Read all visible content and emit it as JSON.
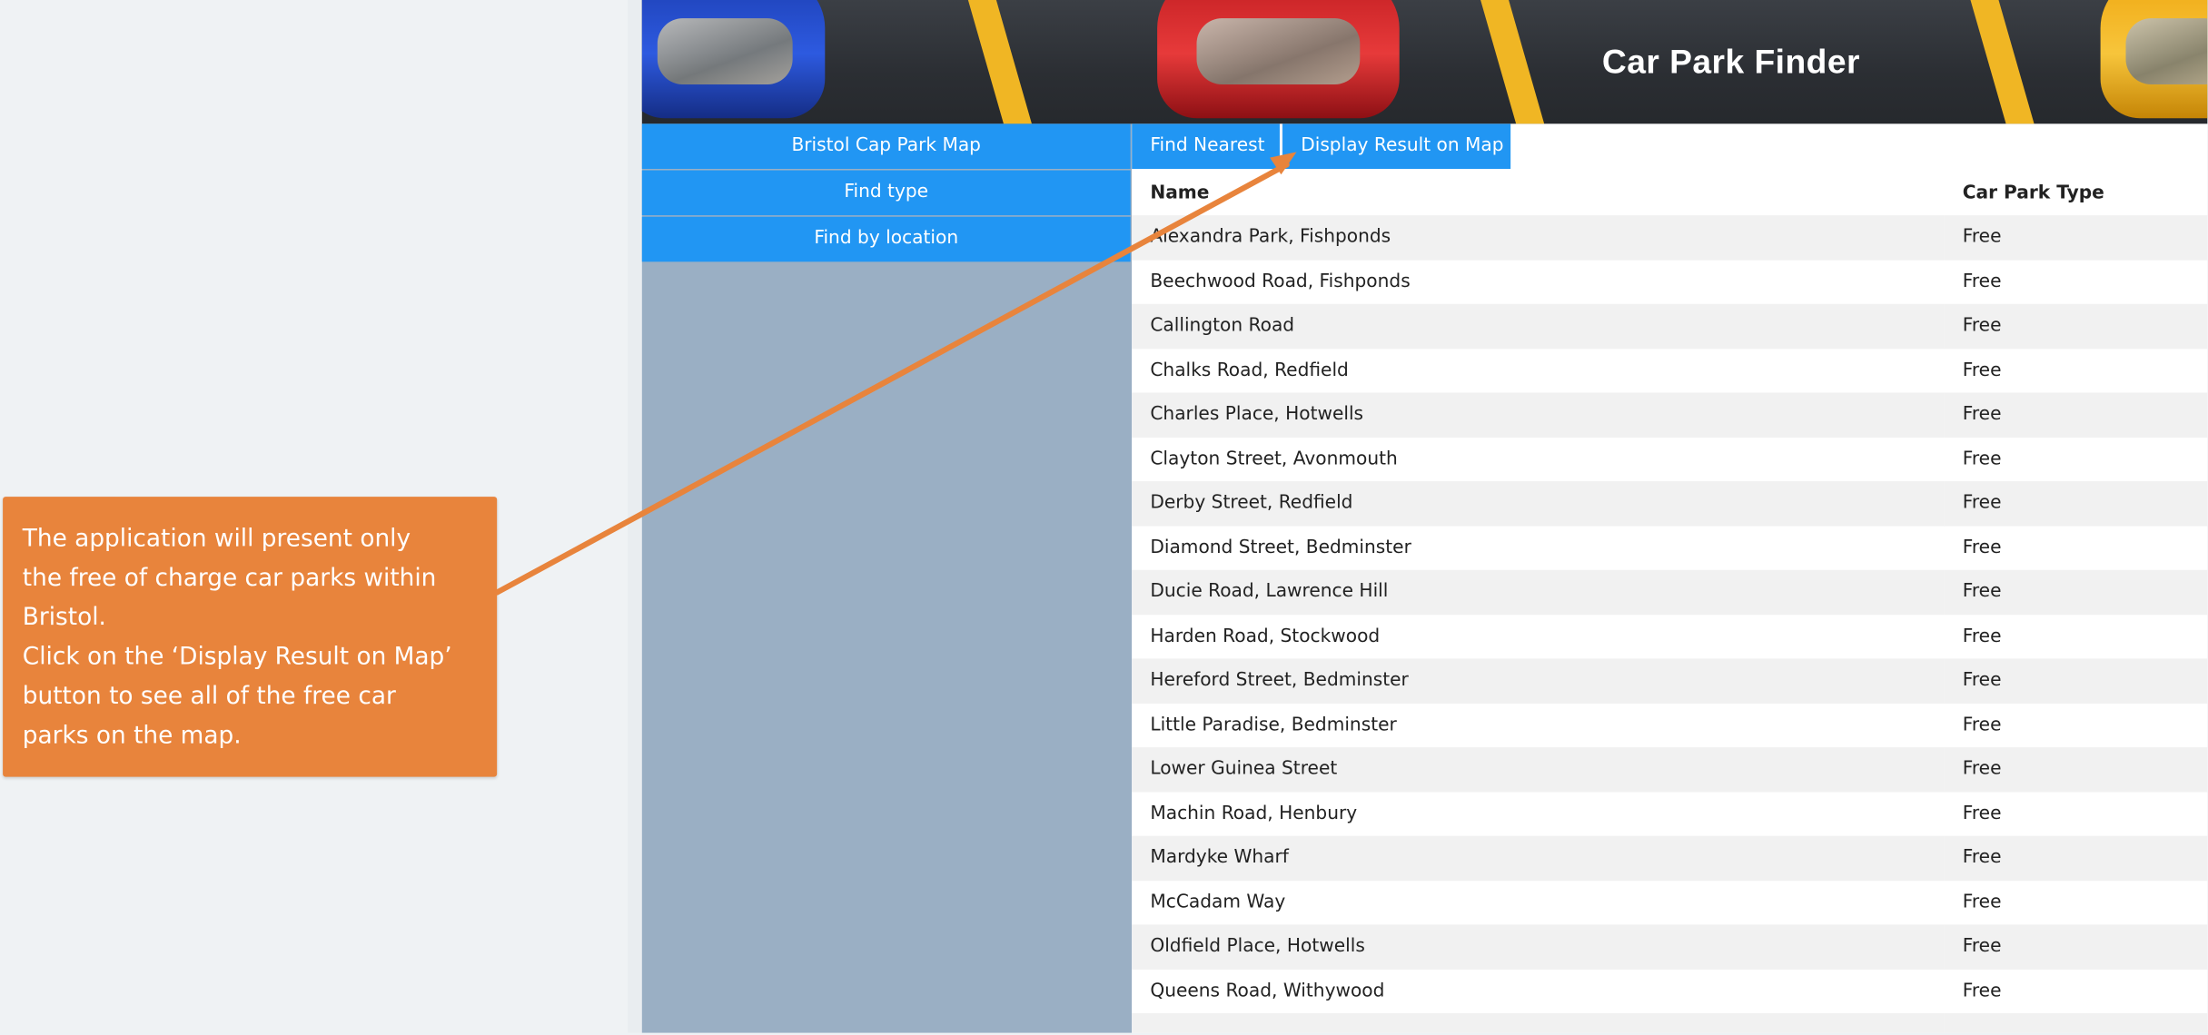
{
  "header": {
    "title": "Car Park Finder"
  },
  "sidebar": {
    "items": [
      {
        "label": "Bristol Cap Park Map"
      },
      {
        "label": "Find type"
      },
      {
        "label": "Find by location"
      }
    ]
  },
  "tabs": [
    {
      "label": "Find Nearest"
    },
    {
      "label": "Display Result on Map"
    }
  ],
  "table": {
    "headers": [
      "Name",
      "Car Park Type"
    ],
    "rows": [
      {
        "name": "Alexandra Park, Fishponds",
        "type": "Free"
      },
      {
        "name": "Beechwood Road, Fishponds",
        "type": "Free"
      },
      {
        "name": "Callington Road",
        "type": "Free"
      },
      {
        "name": "Chalks Road, Redfield",
        "type": "Free"
      },
      {
        "name": "Charles Place, Hotwells",
        "type": "Free"
      },
      {
        "name": "Clayton Street, Avonmouth",
        "type": "Free"
      },
      {
        "name": "Derby Street, Redfield",
        "type": "Free"
      },
      {
        "name": "Diamond Street, Bedminster",
        "type": "Free"
      },
      {
        "name": "Ducie Road, Lawrence Hill",
        "type": "Free"
      },
      {
        "name": "Harden Road, Stockwood",
        "type": "Free"
      },
      {
        "name": "Hereford Street, Bedminster",
        "type": "Free"
      },
      {
        "name": "Little Paradise, Bedminster",
        "type": "Free"
      },
      {
        "name": "Lower Guinea Street",
        "type": "Free"
      },
      {
        "name": "Machin Road, Henbury",
        "type": "Free"
      },
      {
        "name": "Mardyke Wharf",
        "type": "Free"
      },
      {
        "name": "McCadam Way",
        "type": "Free"
      },
      {
        "name": "Oldfield Place, Hotwells",
        "type": "Free"
      },
      {
        "name": "Queens Road, Withywood",
        "type": "Free"
      }
    ]
  },
  "callout": {
    "lines": [
      "The application will present only",
      "the free of charge car parks within",
      "Bristol.",
      "Click on the ‘Display Result on Map’",
      "button to see all of the free car",
      "parks on the map."
    ]
  },
  "colors": {
    "accent": "#2196f3",
    "callout": "#e8843c",
    "sidebar": "#9aafc4"
  }
}
